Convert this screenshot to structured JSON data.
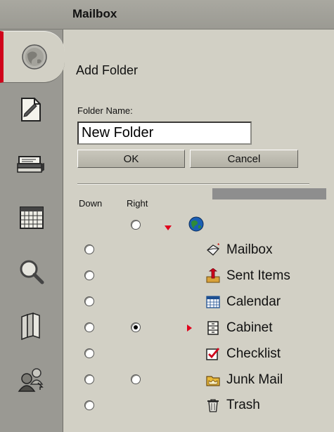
{
  "window": {
    "title": "Mailbox"
  },
  "toolbar": {
    "tools": [
      {
        "icon": "globe-icon",
        "active": true
      },
      {
        "icon": "compose-icon",
        "active": false
      },
      {
        "icon": "address-book-icon",
        "active": false
      },
      {
        "icon": "calendar-grid-icon",
        "active": false
      },
      {
        "icon": "magnifier-icon",
        "active": false
      },
      {
        "icon": "books-icon",
        "active": false
      },
      {
        "icon": "proxy-users-icon",
        "active": false
      }
    ]
  },
  "dialog": {
    "heading": "Add Folder",
    "folder_name_label": "Folder Name:",
    "folder_name_value": "New Folder",
    "ok_label": "OK",
    "cancel_label": "Cancel",
    "col_down": "Down",
    "col_right": "Right"
  },
  "tree": {
    "root": {
      "label": "",
      "icon": "globe-icon",
      "right_selected": false
    },
    "items": [
      {
        "label": "Mailbox",
        "icon": "mailbox-icon",
        "down_selected": false,
        "has_right": false,
        "right_selected": false,
        "pointer": false
      },
      {
        "label": "Sent Items",
        "icon": "sent-items-icon",
        "down_selected": false,
        "has_right": false,
        "right_selected": false,
        "pointer": false
      },
      {
        "label": "Calendar",
        "icon": "calendar-icon",
        "down_selected": false,
        "has_right": false,
        "right_selected": false,
        "pointer": false
      },
      {
        "label": "Cabinet",
        "icon": "cabinet-icon",
        "down_selected": false,
        "has_right": true,
        "right_selected": true,
        "pointer": true
      },
      {
        "label": "Checklist",
        "icon": "checklist-icon",
        "down_selected": false,
        "has_right": false,
        "right_selected": false,
        "pointer": false
      },
      {
        "label": "Junk Mail",
        "icon": "junk-mail-icon",
        "down_selected": false,
        "has_right": true,
        "right_selected": false,
        "pointer": false
      },
      {
        "label": "Trash",
        "icon": "trash-icon",
        "down_selected": false,
        "has_right": false,
        "right_selected": false,
        "pointer": false
      }
    ]
  },
  "colors": {
    "accent": "#d0021b",
    "background": "#d2d0c5",
    "toolbar": "#9a9993"
  }
}
